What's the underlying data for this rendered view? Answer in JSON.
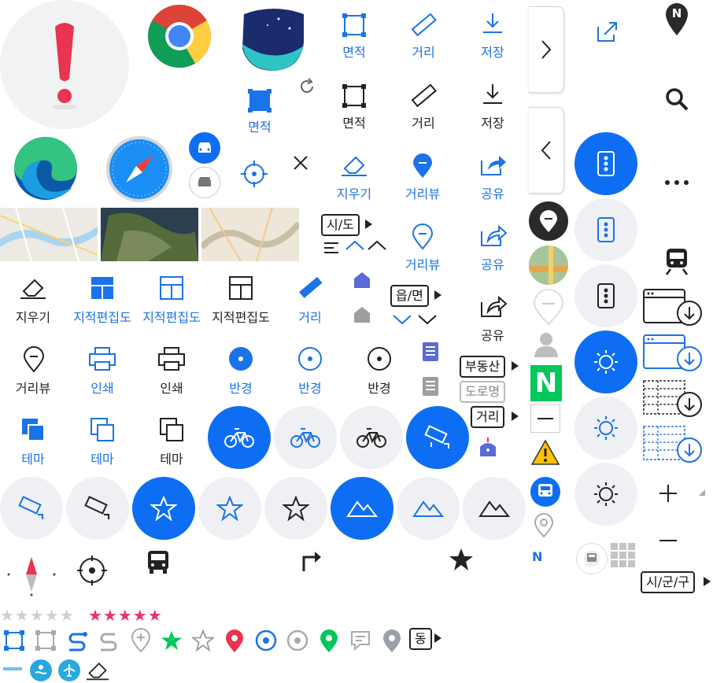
{
  "labels": {
    "area": "면적",
    "distance": "거리",
    "save": "저장",
    "eraser": "지우기",
    "distance_view": "거리뷰",
    "share": "공유",
    "cadastral": "지적편집도",
    "print": "인쇄",
    "radius": "반경",
    "theme": "테마"
  },
  "tags": {
    "sido": "시/도",
    "eupmyeon": "읍/면",
    "realestate": "부동산",
    "road_name": "도로명",
    "distance_tag": "거리",
    "dong": "동",
    "sigungu": "시/군/구"
  },
  "brand": {
    "naver_n": "N",
    "naver_small": "N",
    "pin_n": "N"
  },
  "ratings": {
    "gray_stars": "★★★★★",
    "pink_stars": "★★★★★"
  },
  "colors": {
    "accent": "#0d6ef3",
    "naver_green": "#03c75a",
    "pink": "#e8336d",
    "red_pin": "#e8344e",
    "gray_circle": "#eef0f3"
  }
}
